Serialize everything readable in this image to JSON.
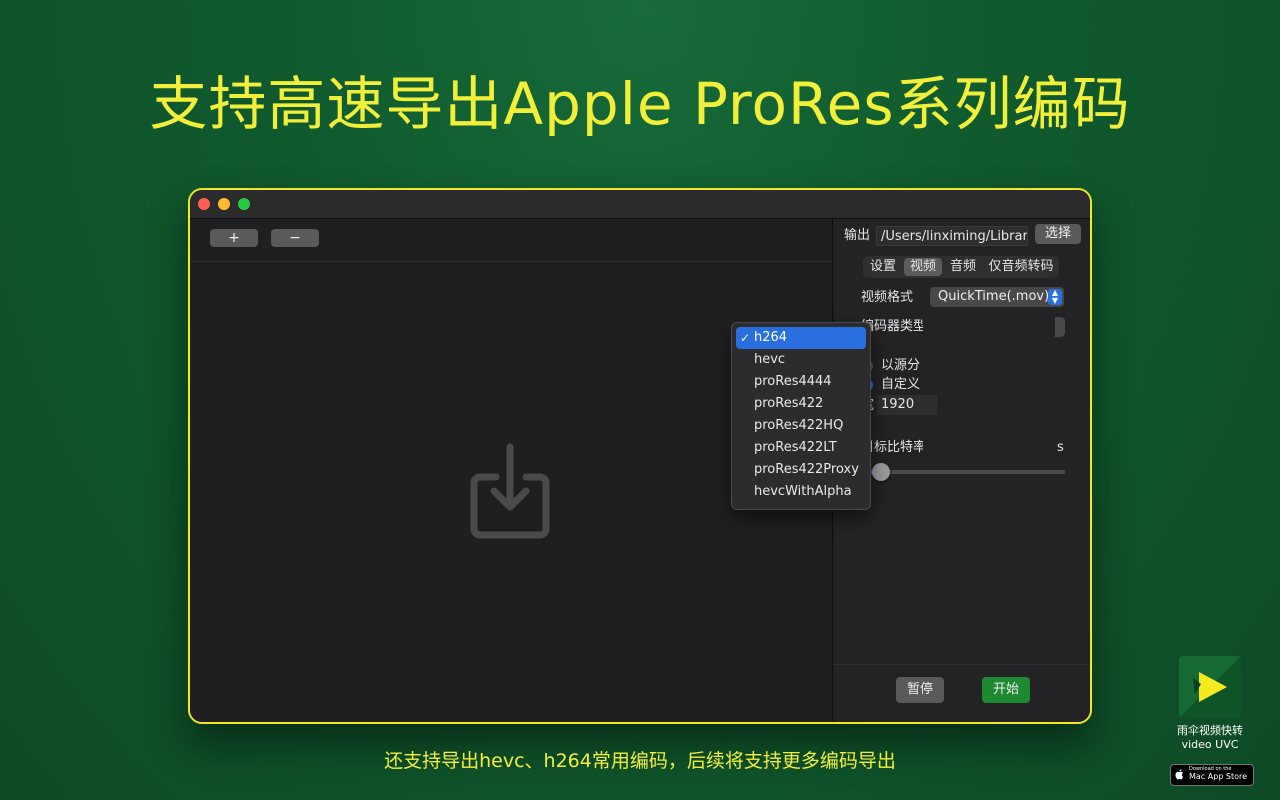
{
  "headline": "支持高速导出Apple ProRes系列编码",
  "subline": "还支持导出hevc、h264常用编码，后续将支持更多编码导出",
  "toolbar": {
    "add_label": "+",
    "remove_label": "−"
  },
  "output": {
    "label": "输出",
    "path": "/Users/linximing/Library/C",
    "choose_label": "选择"
  },
  "tabs": [
    {
      "label": "设置",
      "active": false
    },
    {
      "label": "视频",
      "active": true
    },
    {
      "label": "音频",
      "active": false
    },
    {
      "label": "仅音频转码",
      "active": false
    }
  ],
  "video": {
    "format_label": "视频格式",
    "format_value": "QuickTime(.mov)",
    "encoder_label": "编码器类型",
    "size_source_label": "以源分",
    "size_custom_label": "自定义",
    "width_label": "宽",
    "width_value": "1920",
    "bitrate_label": "目标比特率",
    "bitrate_unit_fragment": "s",
    "bitrate_slider_fraction": 0.1
  },
  "encoder_menu": {
    "selected": "h264",
    "items": [
      "h264",
      "hevc",
      "proRes4444",
      "proRes422",
      "proRes422HQ",
      "proRes422LT",
      "proRes422Proxy",
      "hevcWithAlpha"
    ]
  },
  "actions": {
    "pause_label": "暂停",
    "start_label": "开始"
  },
  "app": {
    "name": "雨伞视频快转",
    "subtitle": "video UVC",
    "store_small": "Download on the",
    "store_big": "Mac App Store"
  },
  "colors": {
    "accent": "#2a6fe0",
    "headline": "#f2ef3a",
    "start_button": "#1d8a32",
    "window_border": "#f0e91c"
  }
}
